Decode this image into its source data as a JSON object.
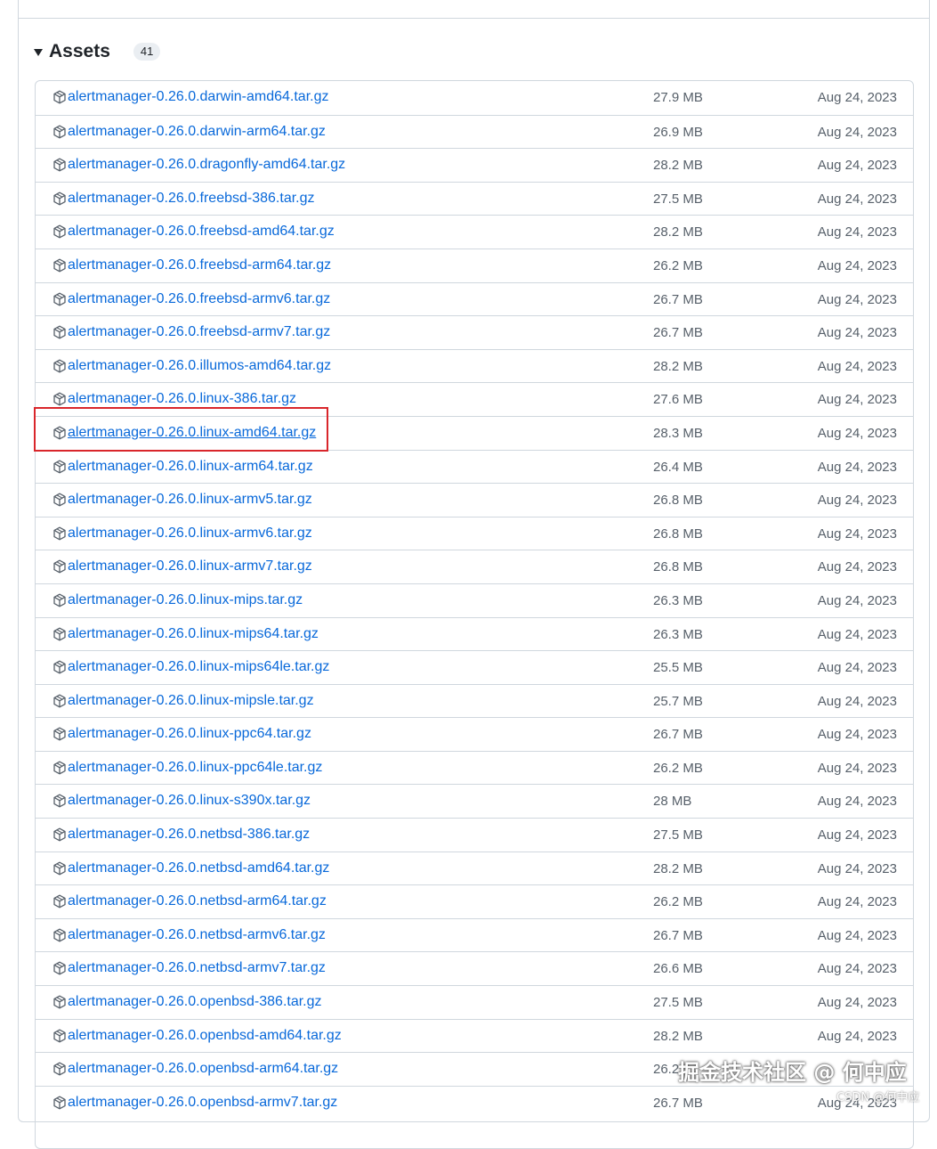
{
  "assets": {
    "title": "Assets",
    "count": "41",
    "files": [
      {
        "name": "alertmanager-0.26.0.darwin-amd64.tar.gz",
        "size": "27.9 MB",
        "date": "Aug 24, 2023"
      },
      {
        "name": "alertmanager-0.26.0.darwin-arm64.tar.gz",
        "size": "26.9 MB",
        "date": "Aug 24, 2023"
      },
      {
        "name": "alertmanager-0.26.0.dragonfly-amd64.tar.gz",
        "size": "28.2 MB",
        "date": "Aug 24, 2023"
      },
      {
        "name": "alertmanager-0.26.0.freebsd-386.tar.gz",
        "size": "27.5 MB",
        "date": "Aug 24, 2023"
      },
      {
        "name": "alertmanager-0.26.0.freebsd-amd64.tar.gz",
        "size": "28.2 MB",
        "date": "Aug 24, 2023"
      },
      {
        "name": "alertmanager-0.26.0.freebsd-arm64.tar.gz",
        "size": "26.2 MB",
        "date": "Aug 24, 2023"
      },
      {
        "name": "alertmanager-0.26.0.freebsd-armv6.tar.gz",
        "size": "26.7 MB",
        "date": "Aug 24, 2023"
      },
      {
        "name": "alertmanager-0.26.0.freebsd-armv7.tar.gz",
        "size": "26.7 MB",
        "date": "Aug 24, 2023"
      },
      {
        "name": "alertmanager-0.26.0.illumos-amd64.tar.gz",
        "size": "28.2 MB",
        "date": "Aug 24, 2023"
      },
      {
        "name": "alertmanager-0.26.0.linux-386.tar.gz",
        "size": "27.6 MB",
        "date": "Aug 24, 2023"
      },
      {
        "name": "alertmanager-0.26.0.linux-amd64.tar.gz",
        "size": "28.3 MB",
        "date": "Aug 24, 2023",
        "highlighted": true
      },
      {
        "name": "alertmanager-0.26.0.linux-arm64.tar.gz",
        "size": "26.4 MB",
        "date": "Aug 24, 2023"
      },
      {
        "name": "alertmanager-0.26.0.linux-armv5.tar.gz",
        "size": "26.8 MB",
        "date": "Aug 24, 2023"
      },
      {
        "name": "alertmanager-0.26.0.linux-armv6.tar.gz",
        "size": "26.8 MB",
        "date": "Aug 24, 2023"
      },
      {
        "name": "alertmanager-0.26.0.linux-armv7.tar.gz",
        "size": "26.8 MB",
        "date": "Aug 24, 2023"
      },
      {
        "name": "alertmanager-0.26.0.linux-mips.tar.gz",
        "size": "26.3 MB",
        "date": "Aug 24, 2023"
      },
      {
        "name": "alertmanager-0.26.0.linux-mips64.tar.gz",
        "size": "26.3 MB",
        "date": "Aug 24, 2023"
      },
      {
        "name": "alertmanager-0.26.0.linux-mips64le.tar.gz",
        "size": "25.5 MB",
        "date": "Aug 24, 2023"
      },
      {
        "name": "alertmanager-0.26.0.linux-mipsle.tar.gz",
        "size": "25.7 MB",
        "date": "Aug 24, 2023"
      },
      {
        "name": "alertmanager-0.26.0.linux-ppc64.tar.gz",
        "size": "26.7 MB",
        "date": "Aug 24, 2023"
      },
      {
        "name": "alertmanager-0.26.0.linux-ppc64le.tar.gz",
        "size": "26.2 MB",
        "date": "Aug 24, 2023"
      },
      {
        "name": "alertmanager-0.26.0.linux-s390x.tar.gz",
        "size": "28 MB",
        "date": "Aug 24, 2023"
      },
      {
        "name": "alertmanager-0.26.0.netbsd-386.tar.gz",
        "size": "27.5 MB",
        "date": "Aug 24, 2023"
      },
      {
        "name": "alertmanager-0.26.0.netbsd-amd64.tar.gz",
        "size": "28.2 MB",
        "date": "Aug 24, 2023"
      },
      {
        "name": "alertmanager-0.26.0.netbsd-arm64.tar.gz",
        "size": "26.2 MB",
        "date": "Aug 24, 2023"
      },
      {
        "name": "alertmanager-0.26.0.netbsd-armv6.tar.gz",
        "size": "26.7 MB",
        "date": "Aug 24, 2023"
      },
      {
        "name": "alertmanager-0.26.0.netbsd-armv7.tar.gz",
        "size": "26.6 MB",
        "date": "Aug 24, 2023"
      },
      {
        "name": "alertmanager-0.26.0.openbsd-386.tar.gz",
        "size": "27.5 MB",
        "date": "Aug 24, 2023"
      },
      {
        "name": "alertmanager-0.26.0.openbsd-amd64.tar.gz",
        "size": "28.2 MB",
        "date": "Aug 24, 2023"
      },
      {
        "name": "alertmanager-0.26.0.openbsd-arm64.tar.gz",
        "size": "26.2",
        "date": ""
      },
      {
        "name": "alertmanager-0.26.0.openbsd-armv7.tar.gz",
        "size": "26.7 MB",
        "date": "Aug 24, 2023"
      }
    ]
  },
  "watermark": {
    "main": "掘金技术社区 @ 何中应",
    "small": "CSDN @何中应"
  },
  "colors": {
    "link": "#0969da",
    "muted": "#57606a",
    "border": "#d0d7de",
    "highlight": "#d9262b"
  }
}
